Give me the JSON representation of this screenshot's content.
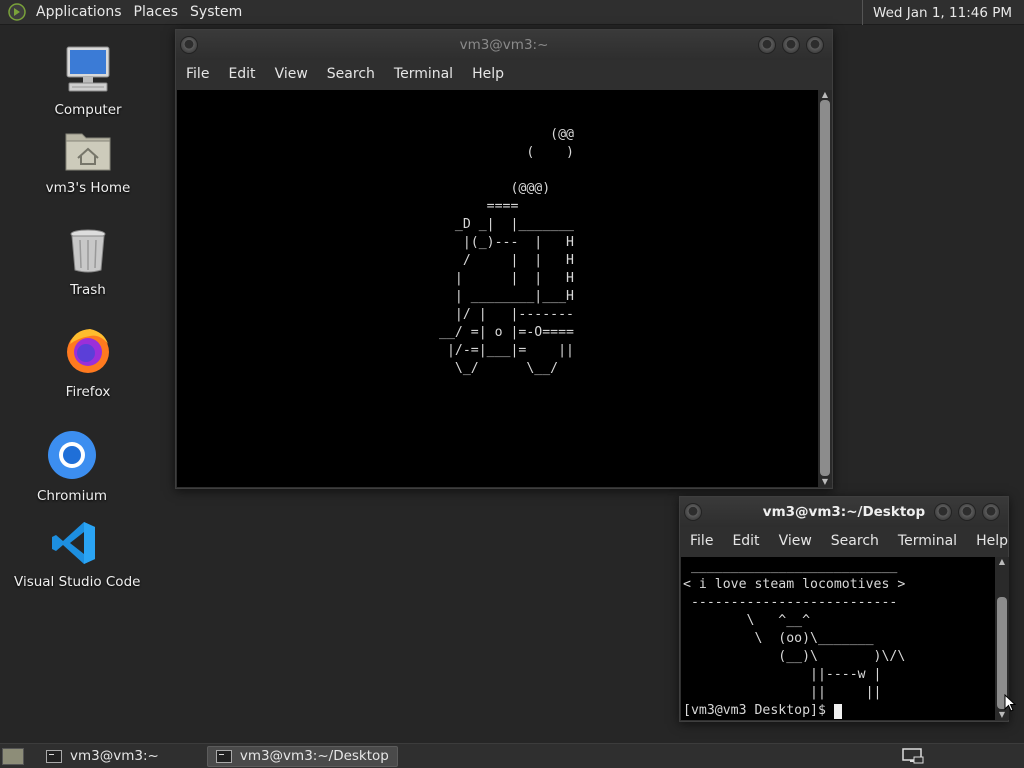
{
  "top_panel": {
    "menus": [
      "Applications",
      "Places",
      "System"
    ],
    "clock": "Wed Jan  1, 11:46 PM"
  },
  "desktop_icons": [
    {
      "label": "Computer",
      "icon": "computer-icon"
    },
    {
      "label": "vm3's Home",
      "icon": "home-folder-icon"
    },
    {
      "label": "Trash",
      "icon": "trash-icon"
    },
    {
      "label": "Firefox",
      "icon": "firefox-icon"
    },
    {
      "label": "Chromium",
      "icon": "chromium-icon"
    },
    {
      "label": "Visual Studio Code",
      "icon": "vscode-icon"
    }
  ],
  "window1": {
    "title": "vm3@vm3:~",
    "menus": [
      "File",
      "Edit",
      "View",
      "Search",
      "Terminal",
      "Help"
    ],
    "output": "                                               (@@\n                                            (    )\n\n                                          (@@@)\n                                       ====\n                                   _D _|  |_______\n                                    |(_)---  |   H\n                                    /     |  |   H\n                                   |      |  |   H\n                                   | ________|___H\n                                   |/ |   |-------\n                                 __/ =| o |=-O====\n                                  |/-=|___|=    ||\n                                   \\_/      \\__/"
  },
  "window2": {
    "title": "vm3@vm3:~/Desktop",
    "menus": [
      "File",
      "Edit",
      "View",
      "Search",
      "Terminal",
      "Help"
    ],
    "output": " __________________________\n< i love steam locomotives >\n --------------------------\n        \\   ^__^\n         \\  (oo)\\_______\n            (__)\\       )\\/\\\n                ||----w |\n                ||     ||",
    "prompt": "[vm3@vm3 Desktop]$ "
  },
  "taskbar": {
    "tasks": [
      {
        "label": "vm3@vm3:~",
        "active": false
      },
      {
        "label": "vm3@vm3:~/Desktop",
        "active": true
      }
    ]
  }
}
